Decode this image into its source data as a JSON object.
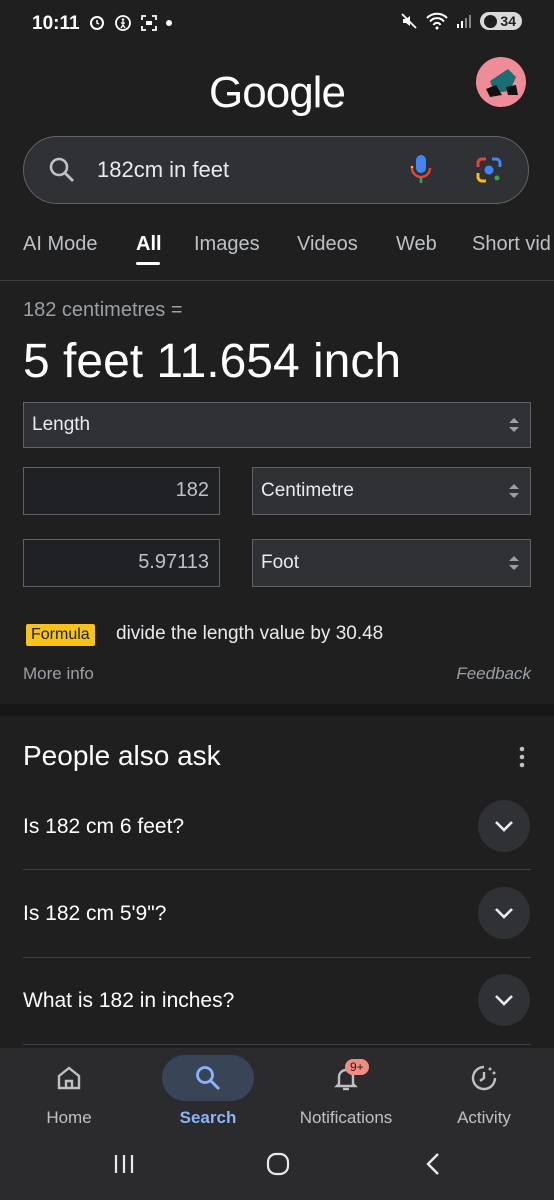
{
  "status_bar": {
    "time": "10:11",
    "battery": "34"
  },
  "logo": "Google",
  "search": {
    "query": "182cm in feet"
  },
  "tabs": [
    "AI Mode",
    "All",
    "Images",
    "Videos",
    "Web",
    "Short vid"
  ],
  "converter": {
    "subtitle": "182 centimetres =",
    "result": "5 feet 11.654 inch",
    "category": "Length",
    "input_value": "182",
    "input_unit": "Centimetre",
    "output_value": "5.97113",
    "output_unit": "Foot",
    "formula_label": "Formula",
    "formula_text": "divide the length value by 30.48",
    "more_info": "More info",
    "feedback": "Feedback"
  },
  "paa": {
    "title": "People also ask",
    "questions": [
      "Is 182 cm 6 feet?",
      "Is 182 cm 5'9\"?",
      "What is 182 in inches?"
    ]
  },
  "nav": {
    "items": [
      {
        "label": "Home",
        "icon": "home-icon"
      },
      {
        "label": "Search",
        "icon": "search-icon"
      },
      {
        "label": "Notifications",
        "icon": "bell-icon",
        "badge": "9+"
      },
      {
        "label": "Activity",
        "icon": "activity-icon"
      }
    ]
  },
  "colors": {
    "accent": "#8ab4f8",
    "formula": "#f6c21b",
    "badge": "#f28b82"
  }
}
